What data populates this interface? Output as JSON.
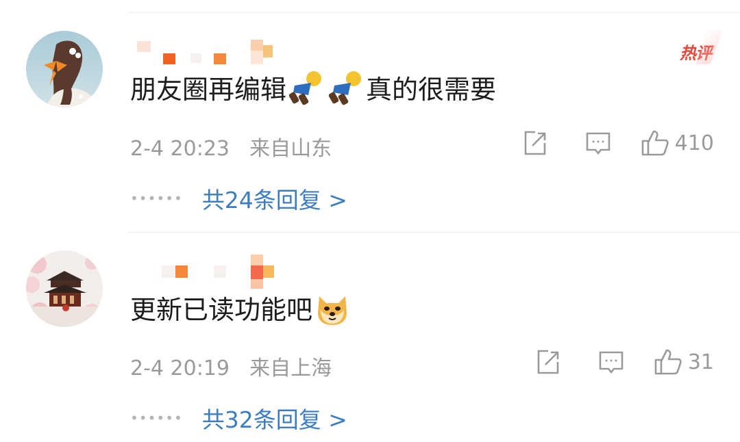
{
  "comments": [
    {
      "text": "朋友圈再编辑",
      "text_after": "真的很需要",
      "emoji_icon": "blue-figure-emoji",
      "timestamp": "2-4 20:23",
      "location": "来自山东",
      "likes": "410",
      "replies_label": "共24条回复 >",
      "hot_badge": "热评"
    },
    {
      "text": "更新已读功能吧",
      "emoji_icon": "doge-emoji",
      "timestamp": "2-4 20:19",
      "location": "来自上海",
      "likes": "31",
      "replies_label": "共32条回复 >"
    }
  ],
  "icons": {
    "share": "share-icon",
    "comment": "comment-icon",
    "like": "thumbs-up-icon",
    "dots": "ellipsis-icon"
  },
  "colors": {
    "link": "#3c7cc0",
    "meta": "#9a9a9a",
    "hot": "#e8473b",
    "text": "#1c1c1c"
  }
}
